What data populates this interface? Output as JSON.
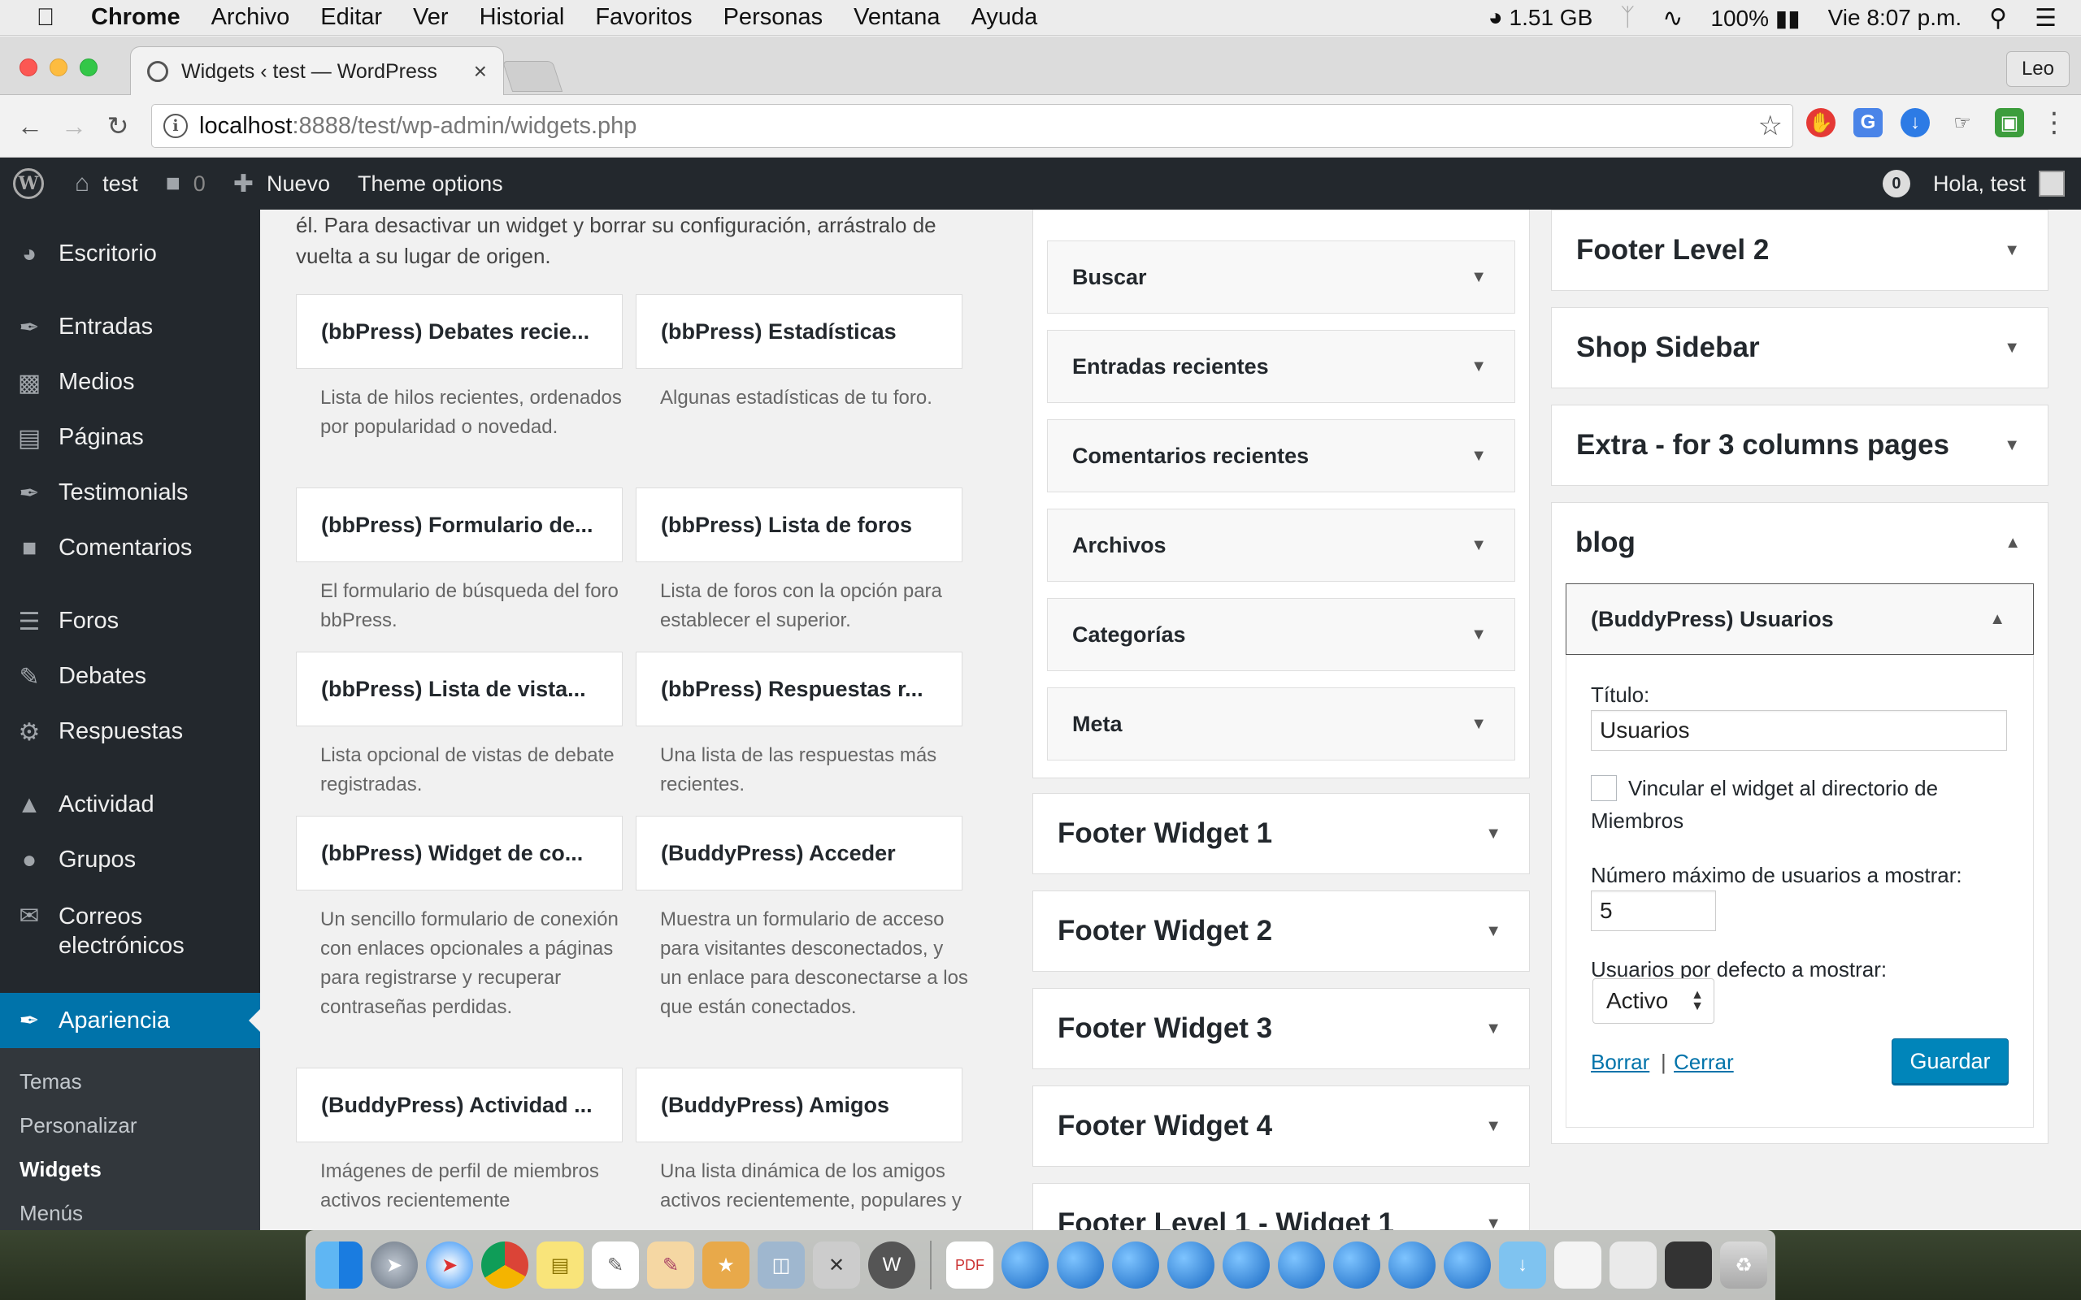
{
  "mac_menubar": {
    "app_name": "Chrome",
    "items": [
      "Archivo",
      "Editar",
      "Ver",
      "Historial",
      "Favoritos",
      "Personas",
      "Ventana",
      "Ayuda"
    ],
    "memory": "1.51 GB",
    "battery": "100%",
    "clock": "Vie 8:07 p.m."
  },
  "browser": {
    "tab_title": "Widgets ‹ test — WordPress",
    "profile": "Leo",
    "url_host": "localhost",
    "url_path": ":8888/test/wp-admin/widgets.php"
  },
  "adminbar": {
    "site": "test",
    "comments_count": "0",
    "new_label": "Nuevo",
    "theme_options": "Theme options",
    "notification_count": "0",
    "greeting": "Hola, test"
  },
  "menu": {
    "items": [
      "Escritorio",
      "Entradas",
      "Medios",
      "Páginas",
      "Testimonials",
      "Comentarios",
      "Foros",
      "Debates",
      "Respuestas",
      "Actividad",
      "Grupos",
      "Correos electrónicos",
      "Apariencia"
    ],
    "current": "Apariencia",
    "submenu": [
      "Temas",
      "Personalizar",
      "Widgets",
      "Menús"
    ],
    "submenu_current": "Widgets"
  },
  "intro_text": "él. Para desactivar un widget y borrar su configuración, arrástralo de vuelta a su lugar de origen.",
  "available_widgets": [
    {
      "title": "(bbPress) Debates recie...",
      "desc": "Lista de hilos recientes, ordenados por popularidad o novedad."
    },
    {
      "title": "(bbPress) Estadísticas",
      "desc": "Algunas estadísticas de tu foro."
    },
    {
      "title": "(bbPress) Formulario de...",
      "desc": "El formulario de búsqueda del foro bbPress."
    },
    {
      "title": "(bbPress) Lista de foros",
      "desc": "Lista de foros con la opción para establecer el superior."
    },
    {
      "title": "(bbPress) Lista de vista...",
      "desc": "Lista opcional de vistas de debate registradas."
    },
    {
      "title": "(bbPress) Respuestas r...",
      "desc": "Una lista de las respuestas más recientes."
    },
    {
      "title": "(bbPress) Widget de co...",
      "desc": "Un sencillo formulario de conexión con enlaces opcionales a páginas para registrarse y recuperar contraseñas perdidas."
    },
    {
      "title": "(BuddyPress) Acceder",
      "desc": "Muestra un formulario de acceso para visitantes desconectados, y un enlace para desconectarse a los que están conectados."
    },
    {
      "title": "(BuddyPress) Actividad ...",
      "desc": "Imágenes de perfil de miembros activos recientemente"
    },
    {
      "title": "(BuddyPress) Amigos",
      "desc": "Una lista dinámica de los amigos activos recientemente, populares y"
    }
  ],
  "sidebar_widgets": [
    "Buscar",
    "Entradas recientes",
    "Comentarios recientes",
    "Archivos",
    "Categorías",
    "Meta"
  ],
  "middle_sidebars": [
    "Footer Widget 1",
    "Footer Widget 2",
    "Footer Widget 3",
    "Footer Widget 4",
    "Footer Level 1 - Widget 1"
  ],
  "right_sidebars": [
    "Footer Level 2",
    "Shop Sidebar",
    "Extra - for 3 columns pages",
    "blog"
  ],
  "open_widget": {
    "title": "(BuddyPress) Usuarios",
    "field_title_label": "Título:",
    "field_title_value": "Usuarios",
    "checkbox_label": "Vincular el widget al directorio de Miembros",
    "max_label": "Número máximo de usuarios a mostrar:",
    "max_value": "5",
    "default_label": "Usuarios por defecto a mostrar:",
    "default_value": "Activo",
    "delete_link": "Borrar",
    "separator": "|",
    "close_link": "Cerrar",
    "save_button": "Guardar"
  },
  "colors": {
    "admin_dark": "#23282d",
    "wp_blue": "#0073aa",
    "button_blue": "#0085ba"
  }
}
